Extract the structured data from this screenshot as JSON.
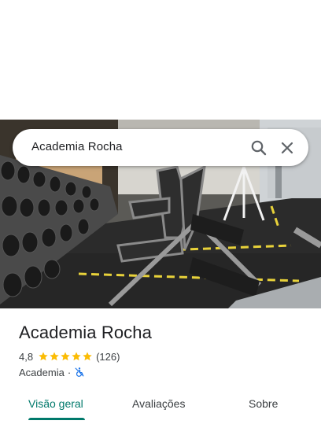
{
  "search": {
    "query": "Academia Rocha"
  },
  "place": {
    "title": "Academia Rocha",
    "rating": "4,8",
    "stars": 5,
    "review_count": "(126)",
    "category": "Academia",
    "separator": "·"
  },
  "tabs": [
    {
      "label": "Visão geral",
      "active": true
    },
    {
      "label": "Avaliações",
      "active": false
    },
    {
      "label": "Sobre",
      "active": false
    }
  ],
  "colors": {
    "accent": "#00796b",
    "star": "#fbbc04",
    "accessibility_icon": "#1a73e8",
    "text": "#202124"
  },
  "icons": {
    "search": "search-icon",
    "close": "close-icon",
    "star": "star-icon",
    "accessibility": "wheelchair-not-accessible-icon"
  }
}
